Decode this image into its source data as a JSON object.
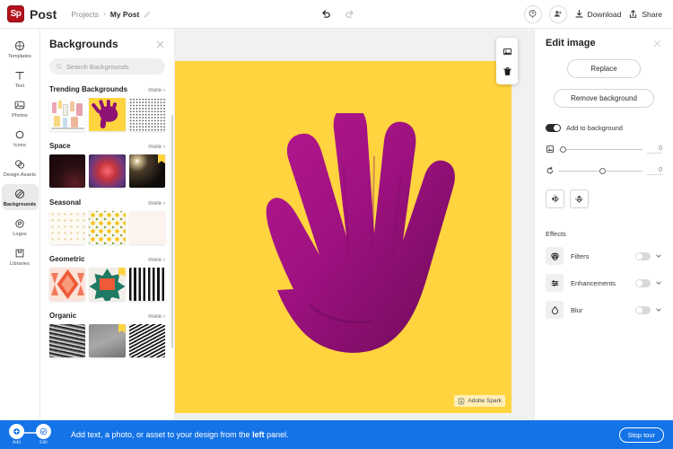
{
  "topbar": {
    "logo_text": "Post",
    "logo_mark": "Sp",
    "breadcrumb": {
      "root": "Projects",
      "separator": "›",
      "current": "My Post",
      "edit_icon": "pencil-icon"
    },
    "undo_icon": "undo-icon",
    "redo_icon": "redo-icon",
    "help_icon": "help-icon",
    "invite_icon": "invite-people-icon",
    "download_label": "Download",
    "download_icon": "download-icon",
    "share_label": "Share",
    "share_icon": "share-icon"
  },
  "rail": {
    "items": [
      {
        "label": "Templates",
        "icon": "templates-icon",
        "active": false
      },
      {
        "label": "Text",
        "icon": "text-icon",
        "active": false
      },
      {
        "label": "Photos",
        "icon": "photos-icon",
        "active": false
      },
      {
        "label": "Icons",
        "icon": "icons-icon",
        "active": false
      },
      {
        "label": "Design Assets",
        "icon": "design-assets-icon",
        "active": false
      },
      {
        "label": "Backgrounds",
        "icon": "backgrounds-icon",
        "active": true
      },
      {
        "label": "Logos",
        "icon": "logos-icon",
        "active": false
      },
      {
        "label": "Libraries",
        "icon": "libraries-icon",
        "active": false
      }
    ]
  },
  "panel": {
    "title": "Backgrounds",
    "close_icon": "close-icon",
    "search": {
      "placeholder": "Search Backgrounds",
      "value": "",
      "icon": "search-icon"
    },
    "more_label": "more ›",
    "sections": [
      {
        "title": "Trending Backgrounds",
        "thumbs": [
          {
            "name": "illustration-people",
            "premium": false,
            "selected": false
          },
          {
            "name": "yellow-hand",
            "premium": false,
            "selected": true
          },
          {
            "name": "dotted-pattern",
            "premium": false,
            "selected": false
          }
        ]
      },
      {
        "title": "Space",
        "thumbs": [
          {
            "name": "dark-red-rays",
            "premium": false,
            "selected": false
          },
          {
            "name": "pink-nebula",
            "premium": false,
            "selected": false
          },
          {
            "name": "starburst-dark",
            "premium": true,
            "selected": false
          }
        ]
      },
      {
        "title": "Seasonal",
        "thumbs": [
          {
            "name": "confetti-light",
            "premium": false,
            "selected": false
          },
          {
            "name": "sunflower-pattern",
            "premium": false,
            "selected": false
          },
          {
            "name": "blush-plain",
            "premium": false,
            "selected": false
          }
        ]
      },
      {
        "title": "Geometric",
        "thumbs": [
          {
            "name": "red-kaleidoscope",
            "premium": false,
            "selected": false
          },
          {
            "name": "quilt-star",
            "premium": true,
            "selected": false
          },
          {
            "name": "vertical-stripes",
            "premium": false,
            "selected": false
          }
        ]
      },
      {
        "title": "Organic",
        "thumbs": [
          {
            "name": "wavy-lines",
            "premium": false,
            "selected": false
          },
          {
            "name": "grey-texture",
            "premium": true,
            "selected": false
          },
          {
            "name": "black-swirls",
            "premium": false,
            "selected": false
          }
        ]
      }
    ]
  },
  "canvas": {
    "background_color": "#FFD43F",
    "artwork_color": "#9E1180",
    "artwork_name": "magenta-hand-photo",
    "watermark": {
      "label": "Adobe Spark",
      "icon": "spark-icon"
    },
    "float_tools": [
      {
        "name": "replace-image-icon"
      },
      {
        "name": "delete-icon"
      }
    ]
  },
  "right": {
    "title": "Edit image",
    "close_icon": "close-icon",
    "replace_label": "Replace",
    "remove_bg_label": "Remove background",
    "add_to_background": {
      "label": "Add to background",
      "on": true
    },
    "sliders": [
      {
        "name": "crop-fade",
        "icon": "crop-icon",
        "value": "0",
        "position_pct": 2
      },
      {
        "name": "rotate",
        "icon": "rotate-icon",
        "value": "0",
        "position_pct": 50
      }
    ],
    "flip_buttons": [
      {
        "name": "flip-horizontal-icon"
      },
      {
        "name": "flip-vertical-icon"
      }
    ],
    "effects_title": "Effects",
    "effects": [
      {
        "label": "Filters",
        "icon": "filters-icon",
        "on": false
      },
      {
        "label": "Enhancements",
        "icon": "enhancements-icon",
        "on": false
      },
      {
        "label": "Blur",
        "icon": "blur-icon",
        "on": false
      }
    ]
  },
  "tour": {
    "steps": [
      {
        "caption": "Add",
        "icon": "add-step-icon"
      },
      {
        "caption": "Edit",
        "icon": "check-icon"
      }
    ],
    "text_before": "Add text, a photo, or asset to your design from the ",
    "text_bold": "left",
    "text_after": " panel.",
    "stop_label": "Stop tour",
    "accent_color": "#1473E6"
  }
}
